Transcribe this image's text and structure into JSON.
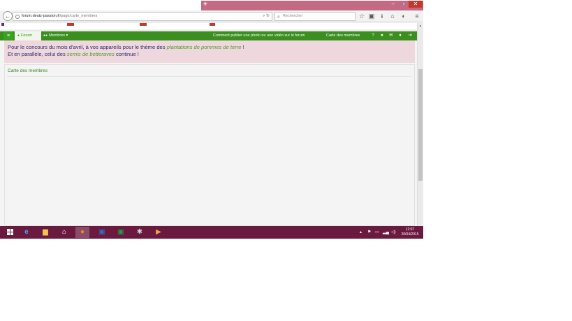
{
  "browser": {
    "url_host": "forum.deutz-passion.fr",
    "url_path": "/page/carte_membres",
    "search_placeholder": "Rechercher",
    "new_tab": "+"
  },
  "forum_nav": {
    "forum_label": "Forum",
    "members_label": "Membres",
    "help_link": "Comment publier une photo ou une vidéo sur le forum",
    "map_link": "Carte des membres"
  },
  "announcement": {
    "line1_prefix": "Pour le concours du mois d'avril, à vos appareils pour le thème des",
    "line1_theme": "plantations de pommes de terre",
    "line1_suffix": "!",
    "line2_prefix": "Et en parallèle, celui des",
    "line2_theme": "semis de betteraves",
    "line2_suffix": "continue !"
  },
  "content": {
    "page_link": "Carte des membres"
  },
  "taskbar": {
    "time": "12:07",
    "date": "20/04/2015"
  },
  "colors": {
    "forum_green": "#3b8f1f",
    "announce_bg": "#efd8dd",
    "taskbar": "#6b1a3f",
    "titlebar_accent": "#c36a85"
  }
}
